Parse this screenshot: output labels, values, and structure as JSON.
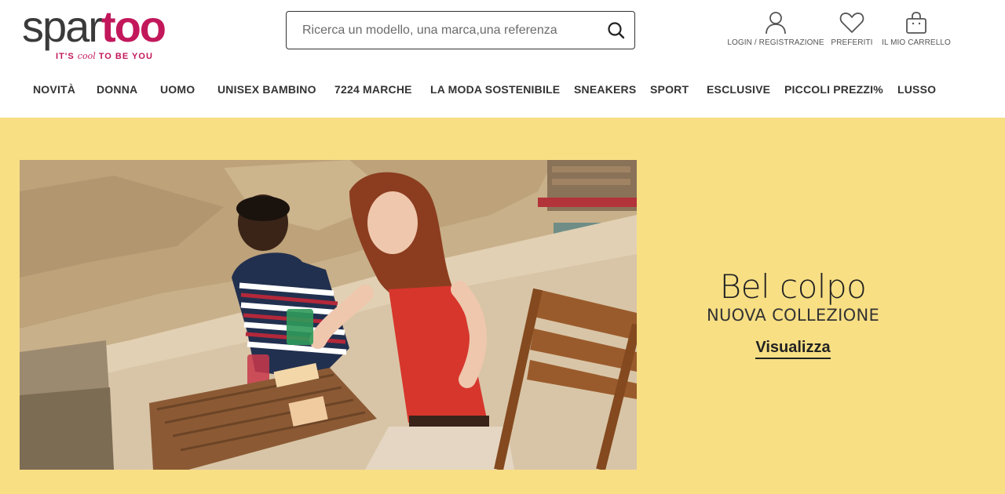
{
  "logo": {
    "word_part1": "spar",
    "word_part2": "too",
    "tagline_pre": "IT'S ",
    "tagline_cool": "cool",
    "tagline_post": " TO BE YOU",
    "colors": {
      "dark": "#3a3a3a",
      "brand": "#c2185b"
    }
  },
  "search": {
    "placeholder": "Ricerca un modello, una marca,una referenza",
    "value": "",
    "icon": "search-icon"
  },
  "account": {
    "login_label": "LOGIN / REGISTRAZIONE",
    "login_icon": "user-icon",
    "favorites_label": "PREFERITI",
    "favorites_icon": "heart-icon",
    "cart_label": "IL MIO CARRELLO",
    "cart_icon": "shopping-bag-icon"
  },
  "nav": {
    "items": [
      {
        "label": "NOVITÀ"
      },
      {
        "label": "DONNA"
      },
      {
        "label": "UOMO"
      },
      {
        "label": "UNISEX BAMBINO"
      },
      {
        "label": "7224 MARCHE"
      },
      {
        "label": "LA MODA SOSTENIBILE"
      },
      {
        "label": "SNEAKERS"
      },
      {
        "label": "SPORT"
      },
      {
        "label": "ESCLUSIVE"
      },
      {
        "label": "PICCOLI PREZZI%"
      },
      {
        "label": "LUSSO"
      }
    ]
  },
  "hero": {
    "title": "Bel colpo",
    "subtitle": "NUOVA COLLEZIONE",
    "cta": "Visualizza",
    "background_color": "#f8df84"
  }
}
